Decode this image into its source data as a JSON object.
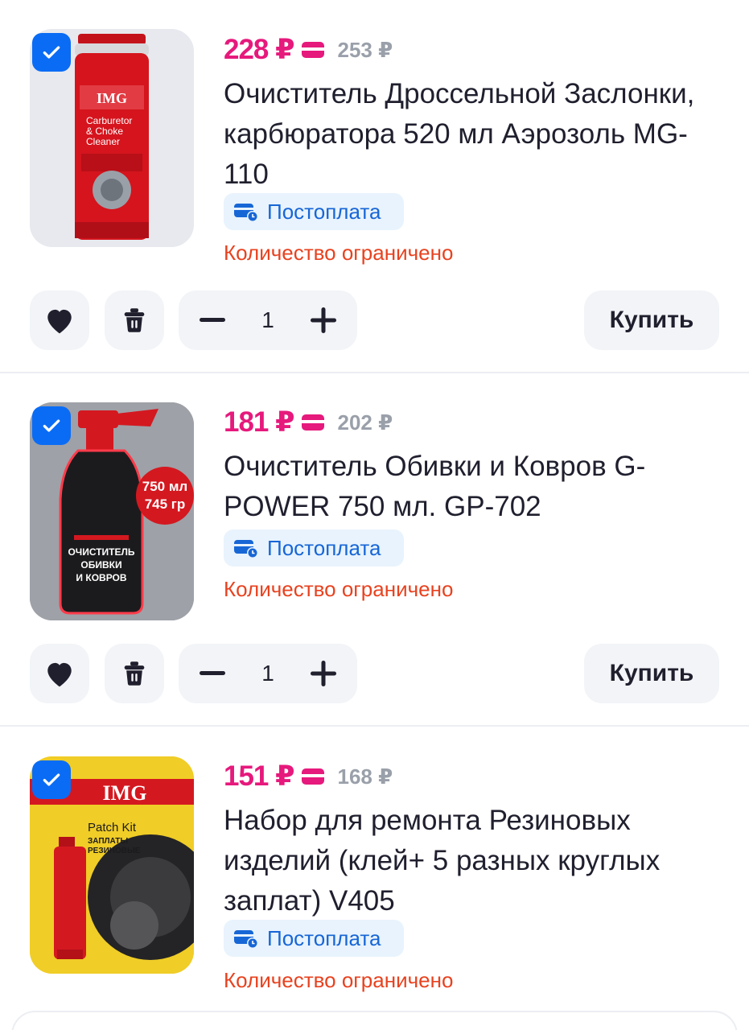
{
  "products": [
    {
      "price": "228 ₽",
      "old_price": "253 ₽",
      "title": "Очиститель Дроссельной Заслонки, карбюратора 520 мл Аэрозоль MG-110",
      "badge": "Постоплата",
      "stock_note": "Количество ограничено",
      "quantity": "1",
      "buy_label": "Купить",
      "image_text": {
        "brand": "IMG",
        "line1": "Carburetor",
        "line2": "& Choke",
        "line3": "Cleaner"
      }
    },
    {
      "price": "181 ₽",
      "old_price": "202 ₽",
      "title": "Очиститель Обивки и Ковров G-POWER 750 мл. GP-702",
      "badge": "Постоплата",
      "stock_note": "Количество ограничено",
      "quantity": "1",
      "buy_label": "Купить",
      "image_text": {
        "volume": "750 мл",
        "weight": "745 гр",
        "line1": "ОЧИСТИТЕЛЬ",
        "line2": "ОБИВКИ",
        "line3": "И КОВРОВ"
      }
    },
    {
      "price": "151 ₽",
      "old_price": "168 ₽",
      "title": "Набор для ремонта Резиновых изделий (клей+ 5 разных круглых заплат) V405",
      "badge": "Постоплата",
      "stock_note": "Количество ограничено",
      "image_text": {
        "brand": "IMG",
        "line1": "Patch Kit",
        "line2": "ЗАПЛАТЫ",
        "line3": "РЕЗИНОВЫЕ"
      }
    }
  ],
  "colors": {
    "price": "#e6197c",
    "old_price": "#9aa0aa",
    "accent": "#0a6cf5",
    "badge_bg": "#e8f3fd",
    "badge_text": "#1766d6",
    "warning": "#e8421f"
  },
  "icons": [
    "checkbox-checked-icon",
    "card-icon",
    "postpay-card-clock-icon",
    "heart-icon",
    "trash-icon",
    "minus-icon",
    "plus-icon"
  ]
}
